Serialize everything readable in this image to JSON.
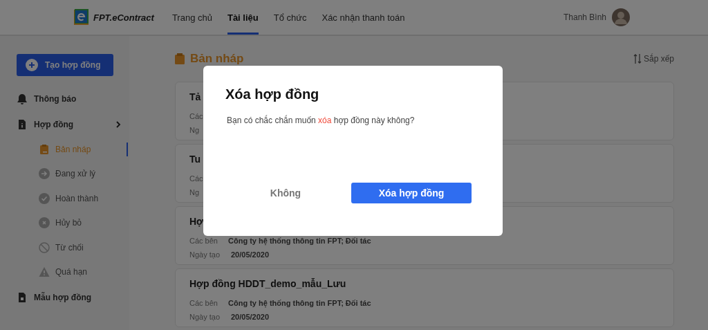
{
  "header": {
    "logo_text": "FPT.eContract",
    "nav": [
      {
        "label": "Trang chủ",
        "selected": false
      },
      {
        "label": "Tài liệu",
        "selected": true
      },
      {
        "label": "Tổ chức",
        "selected": false
      },
      {
        "label": "Xác nhận thanh toán",
        "selected": false
      }
    ],
    "user": {
      "name": "Thanh Bình"
    }
  },
  "sidebar": {
    "create_button": "Tạo hợp đồng",
    "items": [
      {
        "label": "Thông báo",
        "kind": "bell"
      },
      {
        "label": "Hợp đồng",
        "kind": "contract",
        "expanded": true,
        "children": [
          {
            "label": "Bản nháp",
            "kind": "draft",
            "selected": true
          },
          {
            "label": "Đang xử lý",
            "kind": "processing",
            "selected": false
          },
          {
            "label": "Hoàn thành",
            "kind": "done",
            "selected": false
          },
          {
            "label": "Hủy bỏ",
            "kind": "cancelled",
            "selected": false
          },
          {
            "label": "Từ chối",
            "kind": "rejected",
            "selected": false
          },
          {
            "label": "Quá hạn",
            "kind": "overdue",
            "selected": false
          }
        ]
      },
      {
        "label": "Mẫu hợp đồng",
        "kind": "template"
      }
    ]
  },
  "main": {
    "title": "Bản nháp",
    "sort_label": "Sắp xếp",
    "cards": [
      {
        "title": "Tả",
        "parties_label": "Các",
        "date_label": "Ng"
      },
      {
        "title": "Tu",
        "parties_label": "Các",
        "date_label": "Ng"
      },
      {
        "title": "Hợ",
        "parties_label": "Các bên",
        "parties": "Công ty hệ thống thông tin FPT; Đối tác",
        "date_label": "Ngày tạo",
        "date": "20/05/2020"
      },
      {
        "title": "Hợp đồng HDDT_demo_mẫu_Lưu",
        "parties_label": "Các bên",
        "parties": "Công ty hệ thống thông tin FPT; Đối tác",
        "date_label": "Ngày tạo",
        "date": "20/05/2020"
      }
    ]
  },
  "modal": {
    "title": "Xóa hợp đồng",
    "message": [
      {
        "text": "Bạn có chắc chắn muốn ",
        "kind": "plain"
      },
      {
        "text": "xóa",
        "kind": "danger"
      },
      {
        "text": " hợp đồng này không?",
        "kind": "plain"
      }
    ],
    "cancel_button": "Không",
    "confirm_button": "Xóa hợp đồng"
  }
}
